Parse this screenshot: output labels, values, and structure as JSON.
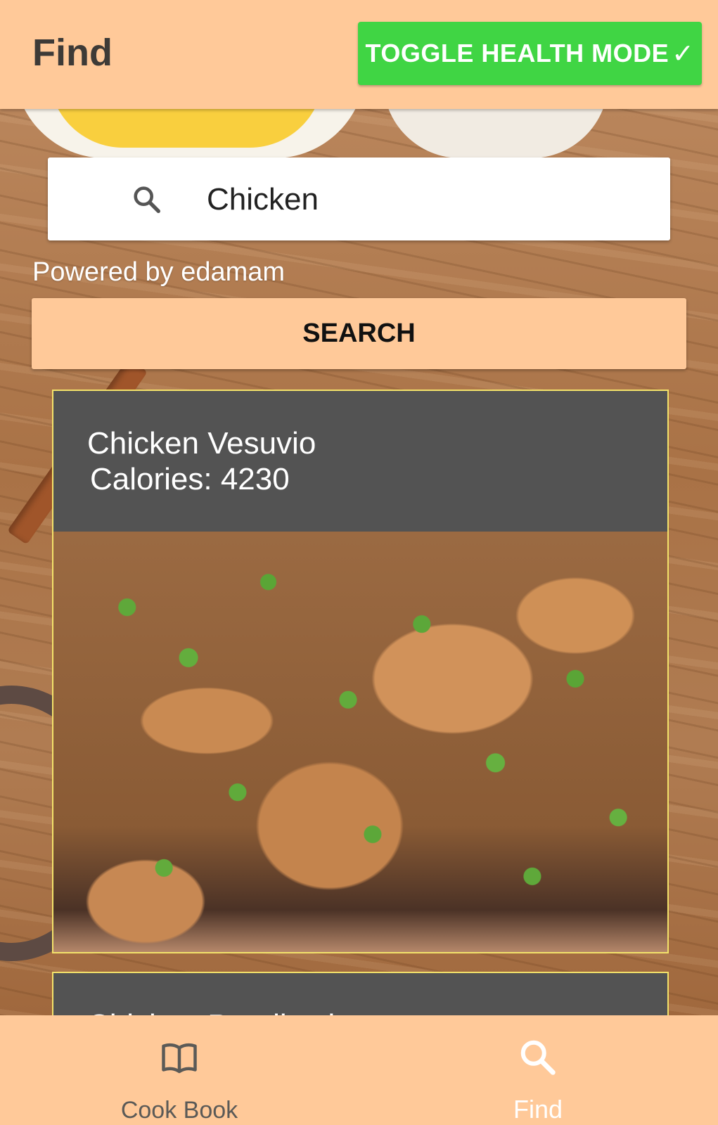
{
  "header": {
    "title": "Find",
    "toggle_label": "TOGGLE HEALTH MODE",
    "toggle_check": "✓",
    "toggle_color": "#40d544",
    "bar_color": "#ffc999"
  },
  "search": {
    "value": "Chicken",
    "powered_by": "Powered by edamam",
    "button_label": "SEARCH"
  },
  "results": [
    {
      "title": "Chicken Vesuvio",
      "calories": "Calories: 4230"
    },
    {
      "title": "Chicken Paprikash",
      "calories": ""
    }
  ],
  "bottom_nav": {
    "items": [
      {
        "label": "Cook Book",
        "icon": "book-open-icon"
      },
      {
        "label": "Find",
        "icon": "search-icon",
        "active": true
      }
    ]
  }
}
